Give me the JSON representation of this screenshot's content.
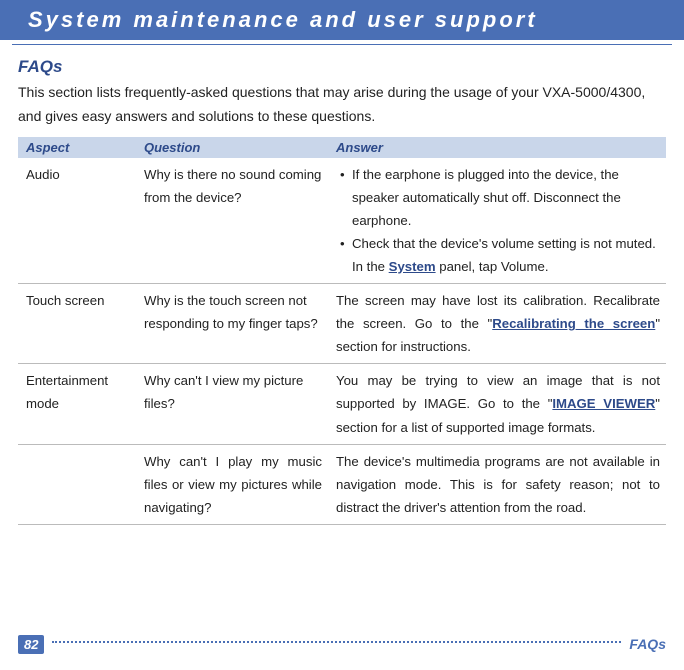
{
  "header": {
    "title": "System maintenance and user support"
  },
  "section": {
    "title": "FAQs",
    "intro": "This section lists frequently-asked questions that may arise during the usage of your VXA-5000/4300, and gives easy answers and solutions to these questions."
  },
  "table": {
    "headers": {
      "aspect": "Aspect",
      "question": "Question",
      "answer": "Answer"
    },
    "rows": [
      {
        "aspect": "Audio",
        "question": "Why is there no sound coming from the device?",
        "answer_bullets": [
          "If the earphone is plugged into the device, the speaker automatically shut off. Disconnect the earphone."
        ],
        "answer_bullet2_pre": "Check that the device's volume setting is not muted. In the ",
        "answer_bullet2_link": "System",
        "answer_bullet2_post": " panel, tap Volume."
      },
      {
        "aspect": "Touch screen",
        "question": "Why is the touch screen not responding to my finger taps?",
        "answer_pre": "The screen may have lost its calibration. Recalibrate the screen. Go to the \"",
        "answer_link": "Recalibrating the screen",
        "answer_post": "\" section for instructions."
      },
      {
        "aspect": "Entertainment mode",
        "question": "Why can't I view my picture files?",
        "answer_pre": "You may be trying to view an image that is not supported by IMAGE. Go to the \"",
        "answer_link": "IMAGE VIEWER",
        "answer_post": "\" section for a list of supported image formats."
      },
      {
        "aspect": "",
        "question": "Why can't I play my music files or view my pictures while navigating?",
        "answer_plain": "The device's multimedia programs are not available in navigation mode. This is for safety reason; not to distract the driver's attention from the road."
      }
    ]
  },
  "footer": {
    "page": "82",
    "label": "FAQs"
  }
}
